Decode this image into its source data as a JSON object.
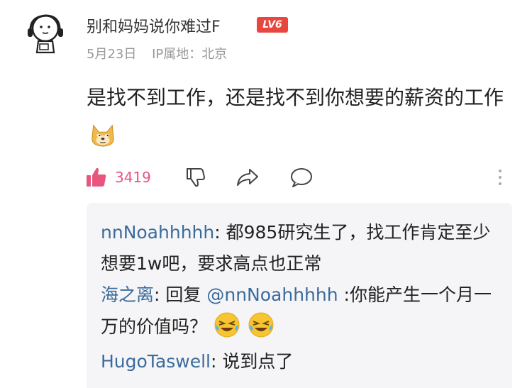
{
  "post": {
    "username": "别和妈妈说你难过F",
    "level_badge": "LV6",
    "date": "5月23日",
    "ip_location": "IP属地：北京",
    "content": "是找不到工作，还是找不到你想要的薪资的工作"
  },
  "actions": {
    "like_count": "3419"
  },
  "replies": [
    {
      "name": "nnNoahhhhh",
      "text": ": 都985研究生了，找工作肯定至少想要1w吧，要求高点也正常"
    },
    {
      "name": "海之离",
      "prefix": ": 回复 ",
      "mention": "@nnNoahhhhh",
      "text": " :你能产生一个月一万的价值吗？"
    },
    {
      "name": "HugoTaswell",
      "text": ": 说到点了"
    }
  ],
  "colors": {
    "accent": "#e8567e",
    "badge": "#e8463e",
    "link": "#3b6b9c"
  }
}
